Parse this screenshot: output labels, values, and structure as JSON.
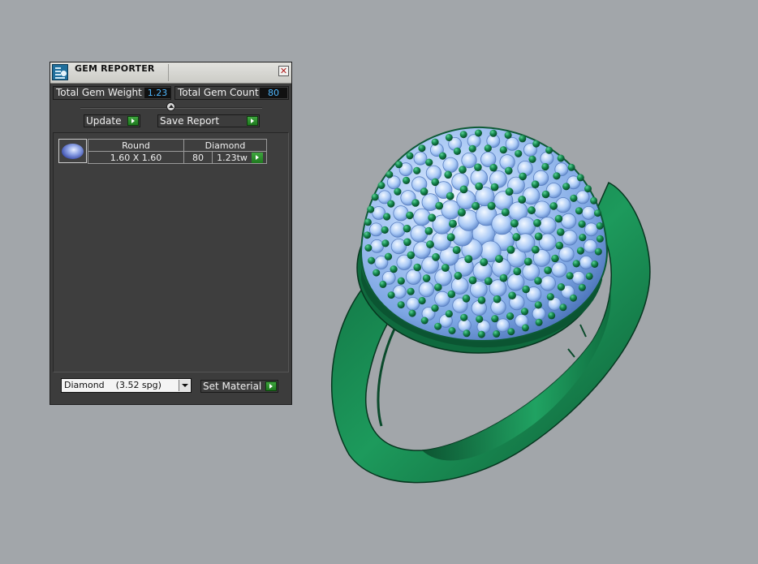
{
  "panel": {
    "title": "GEM REPORTER",
    "close_glyph": "✕",
    "total_weight_label": "Total Gem Weight",
    "total_weight_value": "1.23",
    "total_count_label": "Total Gem Count",
    "total_count_value": "80",
    "update_label": "Update",
    "save_report_label": "Save Report",
    "gems": [
      {
        "shape": "Round",
        "material": "Diamond",
        "size": "1.60 X 1.60",
        "count": "80",
        "weight": "1.23tw"
      }
    ],
    "material_select": "Diamond    (3.52 spg)",
    "set_material_label": "Set Material"
  },
  "colors": {
    "panel_bg": "#3c3c3c",
    "value_text": "#4fb8ff",
    "go_green": "#2e8f2e",
    "metal": "#1e8a55",
    "gem": "#a8c8f5",
    "viewport_bg": "#a2a6aa"
  },
  "icons": {
    "app": "gem-reporter-app-icon",
    "close": "close-icon",
    "go": "green-arrow-icon",
    "gem_thumbnail": "round-gem-icon",
    "dropdown": "chevron-down-icon"
  },
  "viewport": {
    "object": "pave-dome-ring"
  }
}
